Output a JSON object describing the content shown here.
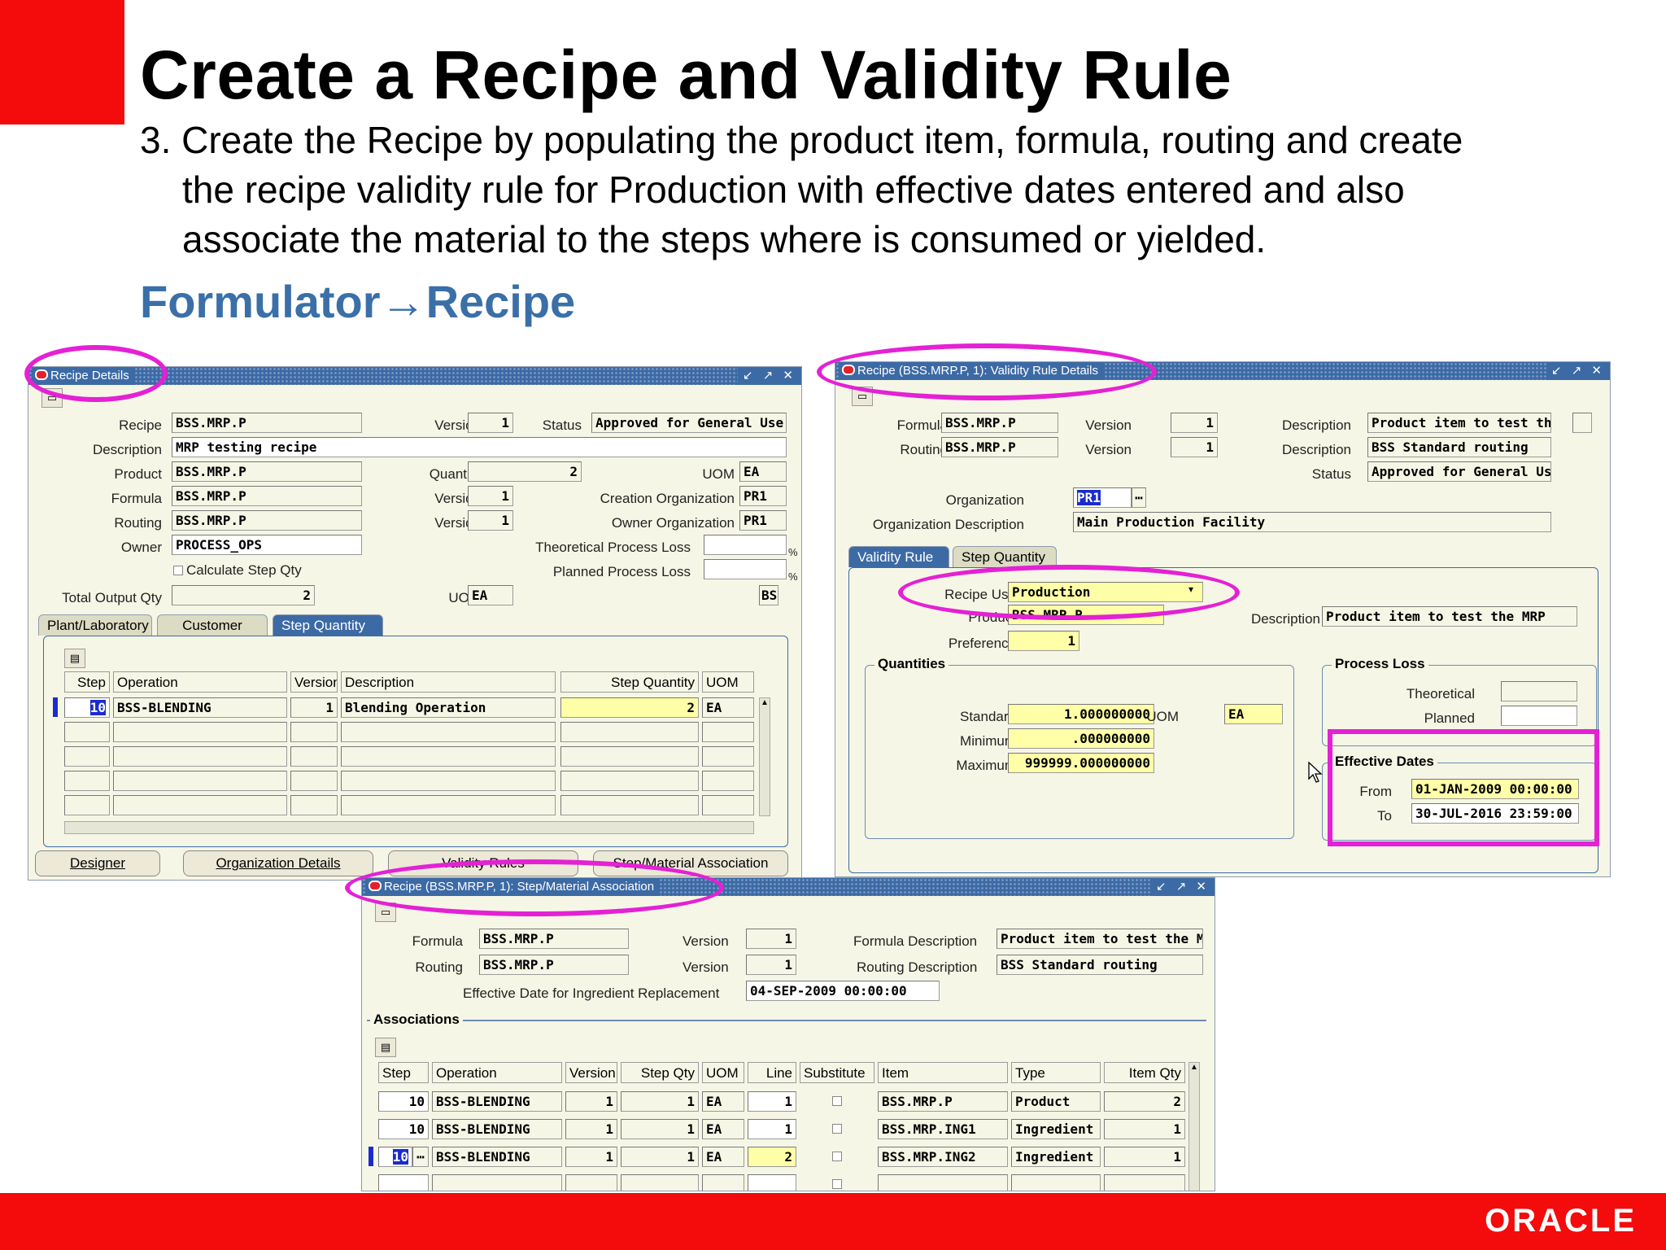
{
  "slide": {
    "title": "Create a Recipe and Validity Rule",
    "step_line1": "3. Create the Recipe by populating the product item, formula, routing and create",
    "step_line2": "the recipe validity rule for Production with effective dates entered and also",
    "step_line3": "associate the material to the steps where is consumed or yielded.",
    "nav_from": "Formulator",
    "nav_arrow": "→",
    "nav_to": "Recipe",
    "logo": "ORACLE"
  },
  "window_controls": "↙ ↗ ✕",
  "recipe_details": {
    "title": "Recipe Details",
    "labels": {
      "recipe": "Recipe",
      "description": "Description",
      "product": "Product",
      "formula": "Formula",
      "routing": "Routing",
      "owner": "Owner",
      "version": "Version",
      "status": "Status",
      "quantity": "Quantity",
      "uom": "UOM",
      "creation_org": "Creation Organization",
      "owner_org": "Owner Organization",
      "theoretical_loss": "Theoretical Process Loss",
      "planned_loss": "Planned Process Loss",
      "calc_step_qty": "Calculate Step Qty",
      "total_output": "Total Output Qty",
      "pct": "%"
    },
    "values": {
      "recipe": "BSS.MRP.P",
      "recipe_version": "1",
      "status": "Approved for General Use",
      "description": "MRP testing recipe",
      "product": "BSS.MRP.P",
      "quantity": "2",
      "uom": "EA",
      "formula": "BSS.MRP.P",
      "formula_version": "1",
      "creation_org": "PR1",
      "routing": "BSS.MRP.P",
      "routing_version": "1",
      "owner_org": "PR1",
      "owner": "PROCESS_OPS",
      "total_output": "2",
      "total_uom": "EA",
      "bs": "BS"
    },
    "tabs": [
      "Plant/Laboratory",
      "Customer",
      "Step Quantity"
    ],
    "grid_headers": [
      "Step",
      "Operation",
      "Version",
      "Description",
      "Step Quantity",
      "UOM"
    ],
    "grid_rows": [
      {
        "step": "10",
        "operation": "BSS-BLENDING",
        "version": "1",
        "description": "Blending Operation",
        "step_qty": "2",
        "uom": "EA"
      }
    ],
    "buttons": [
      "Designer",
      "Organization Details",
      "Validity Rules",
      "Step/Material Association"
    ]
  },
  "validity_rule": {
    "title": "Recipe (BSS.MRP.P, 1): Validity Rule Details",
    "labels": {
      "formula": "Formula",
      "routing": "Routing",
      "version": "Version",
      "description": "Description",
      "status": "Status",
      "organization": "Organization",
      "org_description": "Organization Description",
      "recipe_use": "Recipe Use",
      "product": "Product",
      "preference": "Preference",
      "quantities": "Quantities",
      "standard": "Standard",
      "minimum": "Minimum",
      "maximum": "Maximum",
      "uom": "UOM",
      "process_loss": "Process Loss",
      "theoretical": "Theoretical",
      "planned": "Planned",
      "effective_dates": "Effective Dates",
      "from": "From",
      "to": "To"
    },
    "values": {
      "formula": "BSS.MRP.P",
      "formula_version": "1",
      "formula_description": "Product item to test the M",
      "routing": "BSS.MRP.P",
      "routing_version": "1",
      "routing_description": "BSS Standard routing",
      "status": "Approved for General Use",
      "organization": "PR1",
      "org_description": "Main Production Facility",
      "recipe_use": "Production",
      "product": "BSS.MRP.P",
      "product_description": "Product item to test the MRP",
      "preference": "1",
      "standard": "1.000000000",
      "minimum": ".000000000",
      "maximum": "999999.000000000",
      "uom": "EA",
      "from": "01-JAN-2009 00:00:00",
      "to": "30-JUL-2016 23:59:00"
    },
    "tabs": [
      "Validity Rule",
      "Step Quantity"
    ]
  },
  "step_material": {
    "title": "Recipe (BSS.MRP.P, 1): Step/Material Association",
    "labels": {
      "formula": "Formula",
      "routing": "Routing",
      "version": "Version",
      "formula_description": "Formula Description",
      "routing_description": "Routing Description",
      "effective_date": "Effective Date for Ingredient Replacement",
      "associations": "Associations"
    },
    "values": {
      "formula": "BSS.MRP.P",
      "formula_version": "1",
      "formula_description": "Product item to test the MRP",
      "routing": "BSS.MRP.P",
      "routing_version": "1",
      "routing_description": "BSS Standard routing",
      "effective_date": "04-SEP-2009 00:00:00"
    },
    "grid_headers": [
      "Step",
      "Operation",
      "Version",
      "Step Qty",
      "UOM",
      "Line",
      "Substitute",
      "Item",
      "Type",
      "Item Qty"
    ],
    "grid_rows": [
      {
        "step": "10",
        "operation": "BSS-BLENDING",
        "version": "1",
        "step_qty": "1",
        "uom": "EA",
        "line": "1",
        "item": "BSS.MRP.P",
        "type": "Product",
        "item_qty": "2"
      },
      {
        "step": "10",
        "operation": "BSS-BLENDING",
        "version": "1",
        "step_qty": "1",
        "uom": "EA",
        "line": "1",
        "item": "BSS.MRP.ING1",
        "type": "Ingredient",
        "item_qty": "1"
      },
      {
        "step": "10",
        "operation": "BSS-BLENDING",
        "version": "1",
        "step_qty": "1",
        "uom": "EA",
        "line": "2",
        "item": "BSS.MRP.ING2",
        "type": "Ingredient",
        "item_qty": "1"
      }
    ]
  }
}
